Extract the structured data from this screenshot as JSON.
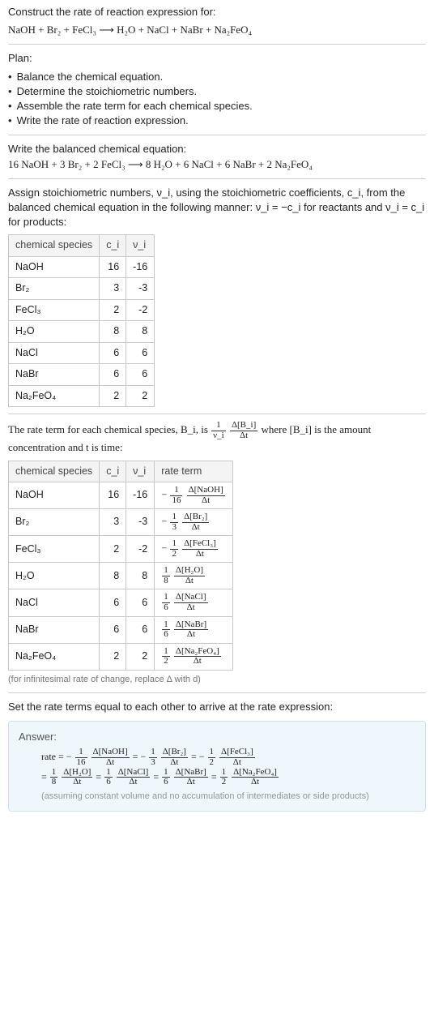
{
  "intro": {
    "prompt": "Construct the rate of reaction expression for:",
    "equation": "NaOH + Br₂ + FeCl₃ ⟶ H₂O + NaCl + NaBr + Na₂FeO₄"
  },
  "plan": {
    "label": "Plan:",
    "items": [
      "Balance the chemical equation.",
      "Determine the stoichiometric numbers.",
      "Assemble the rate term for each chemical species.",
      "Write the rate of reaction expression."
    ]
  },
  "balanced": {
    "label": "Write the balanced chemical equation:",
    "equation": "16 NaOH + 3 Br₂ + 2 FeCl₃ ⟶ 8 H₂O + 6 NaCl + 6 NaBr + 2 Na₂FeO₄"
  },
  "stoich": {
    "intro": "Assign stoichiometric numbers, ν_i, using the stoichiometric coefficients, c_i, from the balanced chemical equation in the following manner: ν_i = −c_i for reactants and ν_i = c_i for products:",
    "headers": [
      "chemical species",
      "c_i",
      "ν_i"
    ],
    "rows": [
      {
        "sp": "NaOH",
        "c": "16",
        "v": "-16"
      },
      {
        "sp": "Br₂",
        "c": "3",
        "v": "-3"
      },
      {
        "sp": "FeCl₃",
        "c": "2",
        "v": "-2"
      },
      {
        "sp": "H₂O",
        "c": "8",
        "v": "8"
      },
      {
        "sp": "NaCl",
        "c": "6",
        "v": "6"
      },
      {
        "sp": "NaBr",
        "c": "6",
        "v": "6"
      },
      {
        "sp": "Na₂FeO₄",
        "c": "2",
        "v": "2"
      }
    ]
  },
  "rate": {
    "intro_a": "The rate term for each chemical species, B_i, is ",
    "intro_b": " where [B_i] is the amount concentration and t is time:",
    "headers": [
      "chemical species",
      "c_i",
      "ν_i",
      "rate term"
    ],
    "rows": [
      {
        "sp": "NaOH",
        "c": "16",
        "v": "-16",
        "rt_pre": "−",
        "rt_num1": "1",
        "rt_den1": "16",
        "rt_num2": "Δ[NaOH]",
        "rt_den2": "Δt"
      },
      {
        "sp": "Br₂",
        "c": "3",
        "v": "-3",
        "rt_pre": "−",
        "rt_num1": "1",
        "rt_den1": "3",
        "rt_num2": "Δ[Br₂]",
        "rt_den2": "Δt"
      },
      {
        "sp": "FeCl₃",
        "c": "2",
        "v": "-2",
        "rt_pre": "−",
        "rt_num1": "1",
        "rt_den1": "2",
        "rt_num2": "Δ[FeCl₃]",
        "rt_den2": "Δt"
      },
      {
        "sp": "H₂O",
        "c": "8",
        "v": "8",
        "rt_pre": "",
        "rt_num1": "1",
        "rt_den1": "8",
        "rt_num2": "Δ[H₂O]",
        "rt_den2": "Δt"
      },
      {
        "sp": "NaCl",
        "c": "6",
        "v": "6",
        "rt_pre": "",
        "rt_num1": "1",
        "rt_den1": "6",
        "rt_num2": "Δ[NaCl]",
        "rt_den2": "Δt"
      },
      {
        "sp": "NaBr",
        "c": "6",
        "v": "6",
        "rt_pre": "",
        "rt_num1": "1",
        "rt_den1": "6",
        "rt_num2": "Δ[NaBr]",
        "rt_den2": "Δt"
      },
      {
        "sp": "Na₂FeO₄",
        "c": "2",
        "v": "2",
        "rt_pre": "",
        "rt_num1": "1",
        "rt_den1": "2",
        "rt_num2": "Δ[Na₂FeO₄]",
        "rt_den2": "Δt"
      }
    ],
    "note": "(for infinitesimal rate of change, replace Δ with d)"
  },
  "final": {
    "lead": "Set the rate terms equal to each other to arrive at the rate expression:"
  },
  "answer": {
    "label": "Answer:",
    "rate_label": "rate = ",
    "chain1": [
      {
        "pre": "−",
        "n1": "1",
        "d1": "16",
        "n2": "Δ[NaOH]",
        "d2": "Δt"
      },
      {
        "pre": "−",
        "n1": "1",
        "d1": "3",
        "n2": "Δ[Br₂]",
        "d2": "Δt"
      },
      {
        "pre": "−",
        "n1": "1",
        "d1": "2",
        "n2": "Δ[FeCl₃]",
        "d2": "Δt"
      }
    ],
    "chain2": [
      {
        "pre": "",
        "n1": "1",
        "d1": "8",
        "n2": "Δ[H₂O]",
        "d2": "Δt"
      },
      {
        "pre": "",
        "n1": "1",
        "d1": "6",
        "n2": "Δ[NaCl]",
        "d2": "Δt"
      },
      {
        "pre": "",
        "n1": "1",
        "d1": "6",
        "n2": "Δ[NaBr]",
        "d2": "Δt"
      },
      {
        "pre": "",
        "n1": "1",
        "d1": "2",
        "n2": "Δ[Na₂FeO₄]",
        "d2": "Δt"
      }
    ],
    "eqsym": " = ",
    "note": "(assuming constant volume and no accumulation of intermediates or side products)"
  },
  "deriv": {
    "pre": "",
    "n1": "1",
    "d1": "ν_i",
    "n2": "Δ[B_i]",
    "d2": "Δt"
  }
}
